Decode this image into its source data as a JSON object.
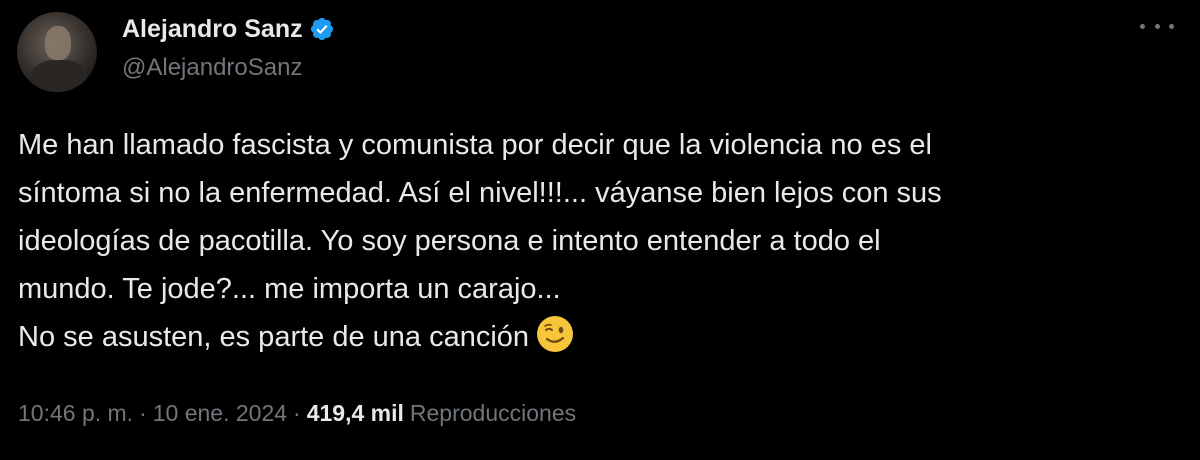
{
  "author": {
    "display_name": "Alejandro Sanz",
    "handle": "@AlejandroSanz",
    "verified": true,
    "verified_color": "#1d9bf0"
  },
  "tweet": {
    "lines": [
      "Me han llamado fascista y comunista por decir que la violencia no es el",
      "síntoma si no la enfermedad. Así el nivel!!!... váyanse bien lejos con sus",
      "ideologías de pacotilla. Yo soy persona e intento entender a todo el",
      "mundo. Te jode?... me importa un carajo...",
      "No se asusten, es parte de una canción"
    ],
    "emoji": "winking-face"
  },
  "meta": {
    "time": "10:46 p. m.",
    "separator": "·",
    "date": "10 ene. 2024",
    "views_count": "419,4 mil",
    "views_label": "Reproducciones"
  },
  "icons": {
    "more": "more-horizontal-icon",
    "verified": "verified-badge-icon"
  },
  "colors": {
    "background": "#000000",
    "text_primary": "#e7e9ea",
    "text_secondary": "#71767b"
  }
}
